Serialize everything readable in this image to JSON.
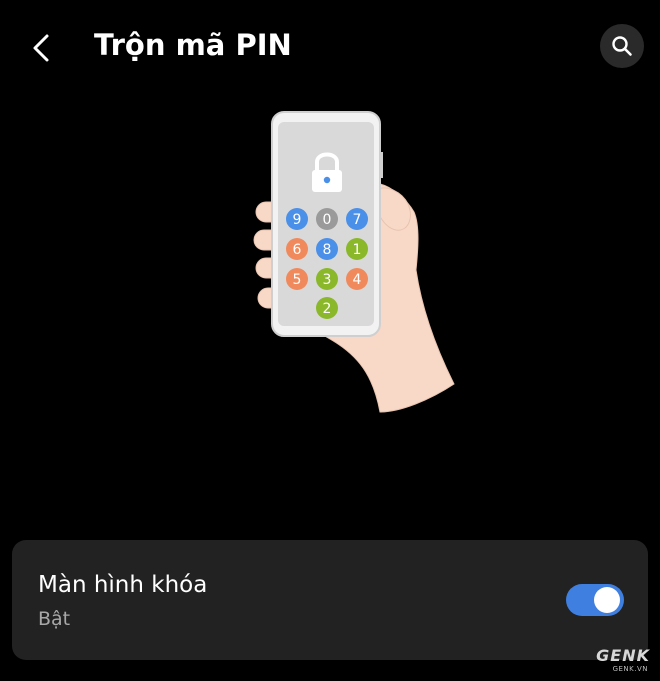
{
  "header": {
    "title": "Trộn mã PIN",
    "back_icon": "back-arrow-icon",
    "search_icon": "search-icon"
  },
  "illustration": {
    "keys": [
      {
        "label": "9",
        "color": "#4a8fe8"
      },
      {
        "label": "0",
        "color": "#9a9a9a"
      },
      {
        "label": "7",
        "color": "#4a8fe8"
      },
      {
        "label": "6",
        "color": "#f08a5d"
      },
      {
        "label": "8",
        "color": "#4a8fe8"
      },
      {
        "label": "1",
        "color": "#8ab82a"
      },
      {
        "label": "5",
        "color": "#f08a5d"
      },
      {
        "label": "3",
        "color": "#8ab82a"
      },
      {
        "label": "4",
        "color": "#f08a5d"
      },
      {
        "label": "2",
        "color": "#8ab82a"
      }
    ]
  },
  "setting": {
    "title": "Màn hình khóa",
    "status": "Bật",
    "enabled": true,
    "accent_color": "#3f7fe0"
  },
  "watermark": {
    "main": "GENK",
    "sub": "GENK.VN"
  }
}
